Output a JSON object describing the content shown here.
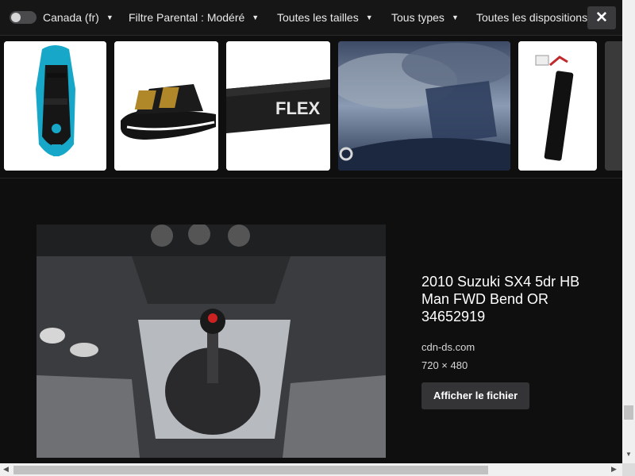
{
  "filters": {
    "region": "Canada (fr)",
    "safe_search": "Filtre Parental : Modéré",
    "size": "Toutes les tailles",
    "type": "Tous types",
    "layout": "Toutes les dispositions"
  },
  "close_label": "✕",
  "thumbnails": [
    {
      "name": "snowshoe",
      "icon": "snowshoe-image"
    },
    {
      "name": "sandal",
      "icon": "sandal-image"
    },
    {
      "name": "flex-bag",
      "icon": "flex-bag-image",
      "text": "FLEX"
    },
    {
      "name": "stormy-laptop",
      "icon": "laptop-storm-image"
    },
    {
      "name": "battery",
      "icon": "battery-image"
    }
  ],
  "detail": {
    "title": "2010 Suzuki SX4 5dr HB Man FWD Bend OR 34652919",
    "domain": "cdn-ds.com",
    "dimensions": "720 × 480",
    "open_button": "Afficher le fichier"
  },
  "colors": {
    "background": "#0f0f10",
    "topbar": "#161617",
    "button": "#343437"
  }
}
